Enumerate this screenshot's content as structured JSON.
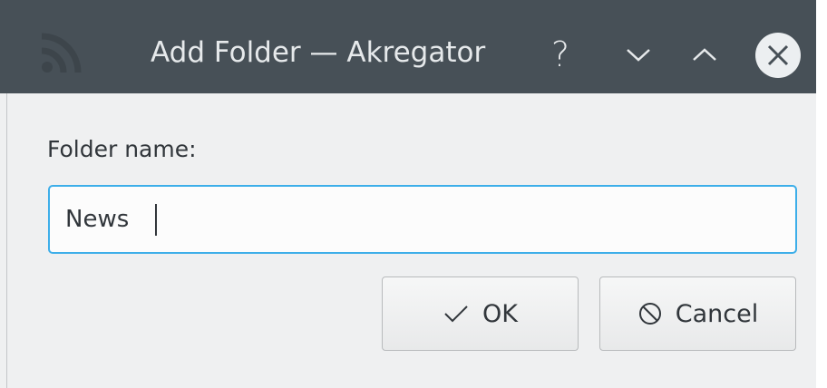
{
  "window": {
    "title": "Add Folder — Akregator",
    "app_icon": "rss-feed-icon",
    "help_symbol": "?",
    "controls": [
      "help-icon",
      "minimize-icon",
      "maximize-icon",
      "close-icon"
    ]
  },
  "form": {
    "folder_label": "Folder name:",
    "folder_value": "News"
  },
  "buttons": {
    "ok_label": "OK",
    "ok_icon": "checkmark-icon",
    "cancel_label": "Cancel",
    "cancel_icon": "cancel-circle-icon"
  },
  "colors": {
    "titlebar": "#475057",
    "accent": "#3daee9",
    "background": "#eff0f1",
    "text": "#31363b"
  }
}
